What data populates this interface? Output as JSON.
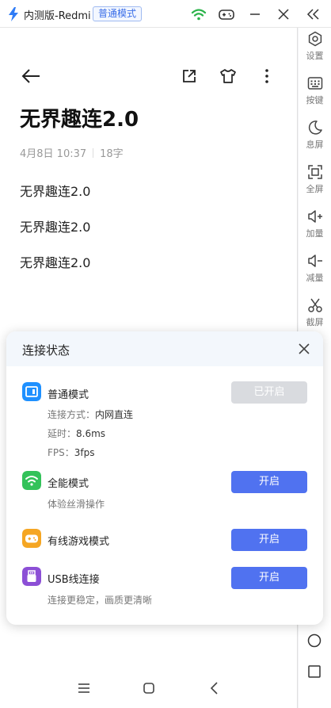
{
  "titlebar": {
    "title": "内测版-Redmi",
    "mode_badge": "普通模式"
  },
  "sidebar": {
    "items": [
      {
        "label": "设置",
        "icon": "settings-icon"
      },
      {
        "label": "按键",
        "icon": "keyboard-icon"
      },
      {
        "label": "息屏",
        "icon": "moon-icon"
      },
      {
        "label": "全屏",
        "icon": "fullscreen-icon"
      },
      {
        "label": "加量",
        "icon": "volume-up-icon"
      },
      {
        "label": "减量",
        "icon": "volume-down-icon"
      },
      {
        "label": "截屏",
        "icon": "scissors-icon"
      }
    ]
  },
  "note": {
    "title": "无界趣连2.0",
    "date": "4月8日 10:37",
    "word_count": "18字",
    "lines": [
      "无界趣连2.0",
      "无界趣连2.0",
      "无界趣连2.0"
    ]
  },
  "dialog": {
    "title": "连接状态",
    "modes": [
      {
        "name": "普通模式",
        "button": "已开启",
        "color": "#1e90ff",
        "details": [
          {
            "label": "连接方式：",
            "value": "内网直连"
          },
          {
            "label": "延时：",
            "value": "8.6ms"
          },
          {
            "label": "FPS：",
            "value": "3fps"
          }
        ]
      },
      {
        "name": "全能模式",
        "button": "开启",
        "color": "#33c25a",
        "subtitle": "体验丝滑操作"
      },
      {
        "name": "有线游戏模式",
        "button": "开启",
        "color": "#f5a623"
      },
      {
        "name": "USB线连接",
        "button": "开启",
        "color": "#8c4fd6",
        "subtitle": "连接更稳定，画质更清晰"
      }
    ]
  },
  "colors": {
    "accent": "#5072f0",
    "disabled_button": "#d9dbdf"
  }
}
